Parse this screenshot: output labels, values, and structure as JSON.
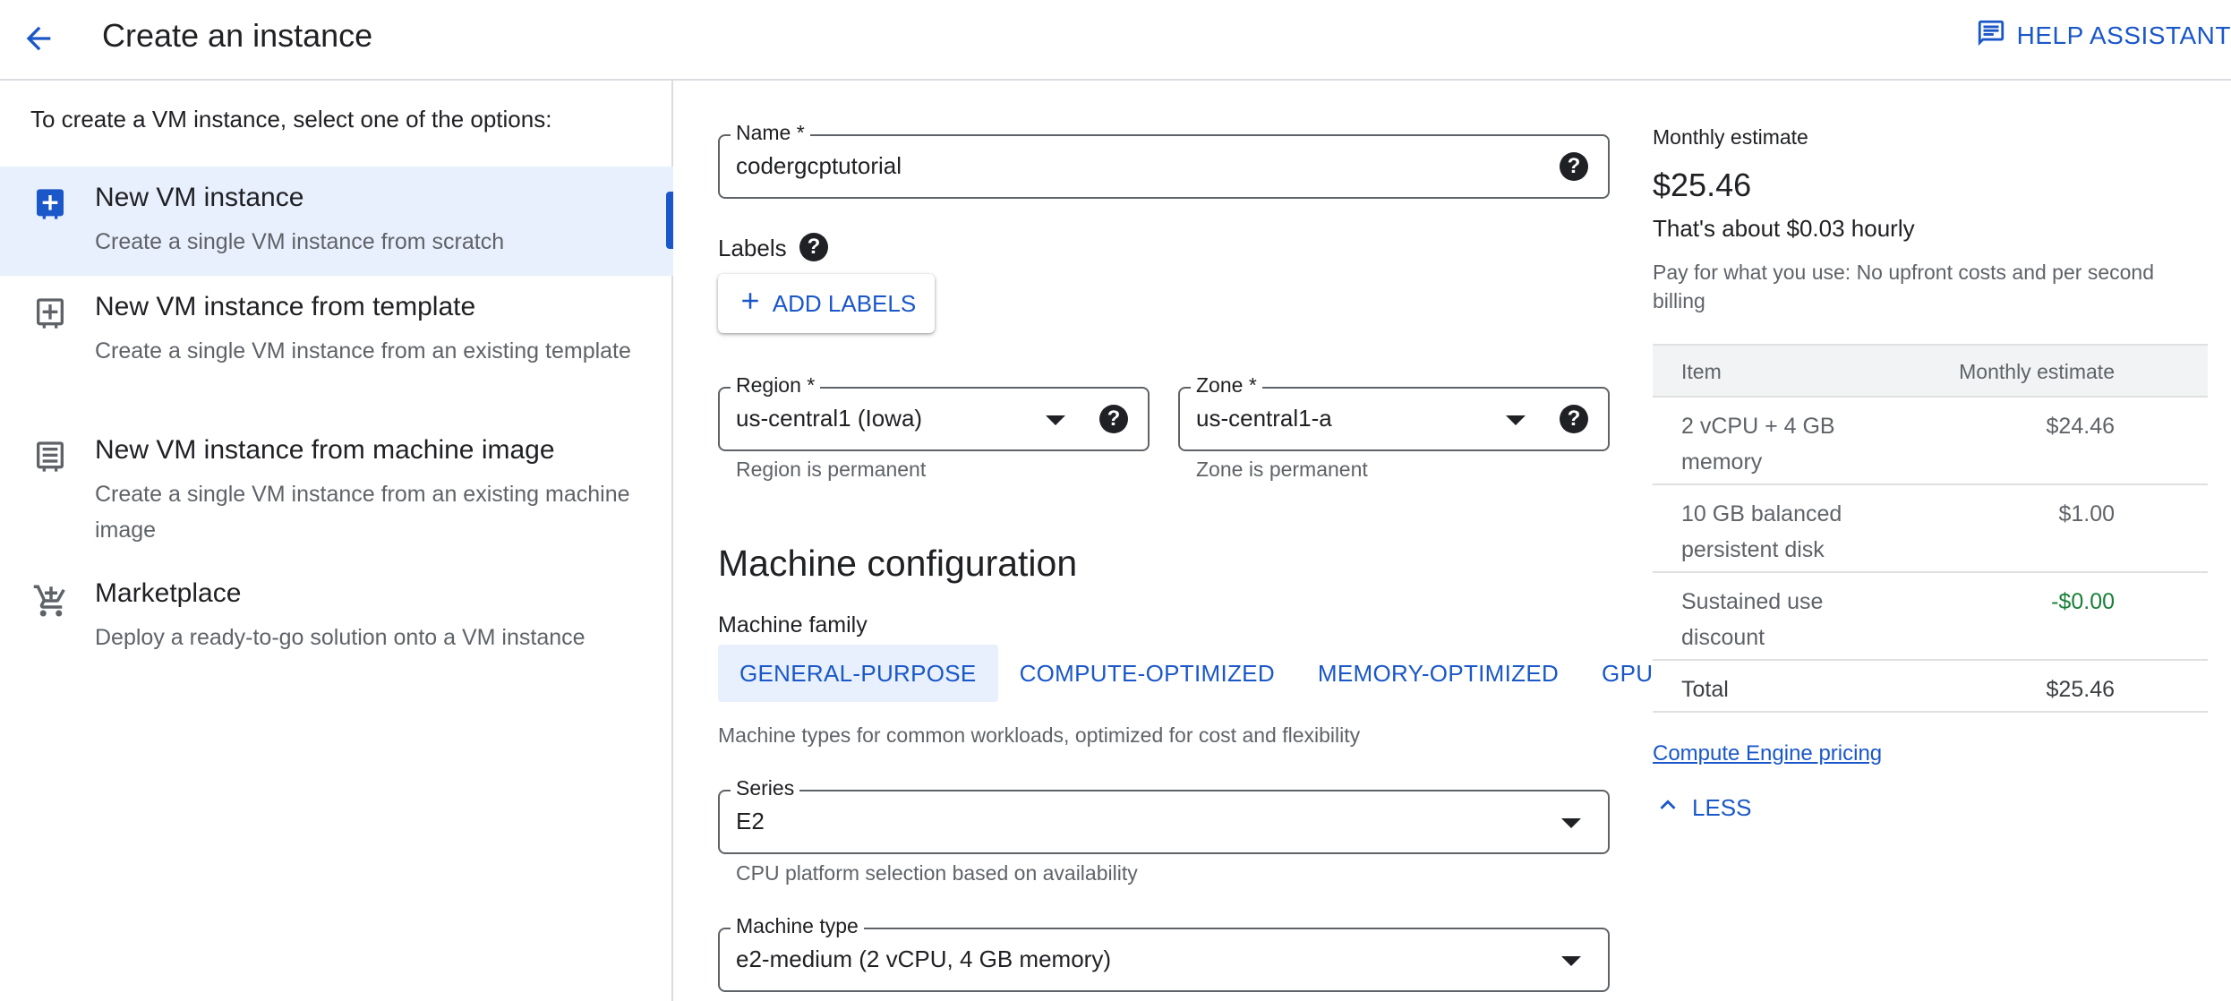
{
  "header": {
    "title": "Create an instance",
    "help_label": "HELP ASSISTANT"
  },
  "left": {
    "intro": "To create a VM instance, select one of the options:",
    "options": [
      {
        "title": "New VM instance",
        "desc": "Create a single VM instance from scratch",
        "icon": "add-box-icon",
        "selected": true
      },
      {
        "title": "New VM instance from template",
        "desc": "Create a single VM instance from an existing template",
        "icon": "template-icon",
        "selected": false
      },
      {
        "title": "New VM instance from machine image",
        "desc": "Create a single VM instance from an existing machine image",
        "icon": "machine-image-icon",
        "selected": false
      },
      {
        "title": "Marketplace",
        "desc": "Deploy a ready-to-go solution onto a VM instance",
        "icon": "cart-icon",
        "selected": false
      }
    ]
  },
  "form": {
    "name": {
      "label": "Name *",
      "value": "codergcptutorial"
    },
    "labels": {
      "title": "Labels",
      "add_button": "ADD LABELS"
    },
    "region": {
      "label": "Region *",
      "value": "us-central1 (Iowa)",
      "hint": "Region is permanent"
    },
    "zone": {
      "label": "Zone *",
      "value": "us-central1-a",
      "hint": "Zone is permanent"
    },
    "machine_config": {
      "title": "Machine configuration",
      "family_label": "Machine family",
      "tabs": [
        "GENERAL-PURPOSE",
        "COMPUTE-OPTIMIZED",
        "MEMORY-OPTIMIZED",
        "GPU"
      ],
      "active_tab": "GENERAL-PURPOSE",
      "family_desc": "Machine types for common workloads, optimized for cost and flexibility",
      "series": {
        "label": "Series",
        "value": "E2",
        "hint": "CPU platform selection based on availability"
      },
      "machine_type": {
        "label": "Machine type",
        "value": "e2-medium (2 vCPU, 4 GB memory)"
      }
    }
  },
  "estimate": {
    "title": "Monthly estimate",
    "amount": "$25.46",
    "hourly": "That's about $0.03 hourly",
    "note": "Pay for what you use: No upfront costs and per second billing",
    "table": {
      "col_item": "Item",
      "col_estimate": "Monthly estimate",
      "rows": [
        {
          "item": "2 vCPU + 4 GB memory",
          "value": "$24.46"
        },
        {
          "item": "10 GB balanced persistent disk",
          "value": "$1.00"
        },
        {
          "item": "Sustained use discount",
          "value": "-$0.00"
        }
      ],
      "total_label": "Total",
      "total_value": "$25.46"
    },
    "pricing_link": "Compute Engine pricing",
    "less_label": "LESS"
  },
  "colors": {
    "accent": "#1a57c8",
    "selected_bg": "#e8f0fe",
    "discount": "#188038"
  }
}
